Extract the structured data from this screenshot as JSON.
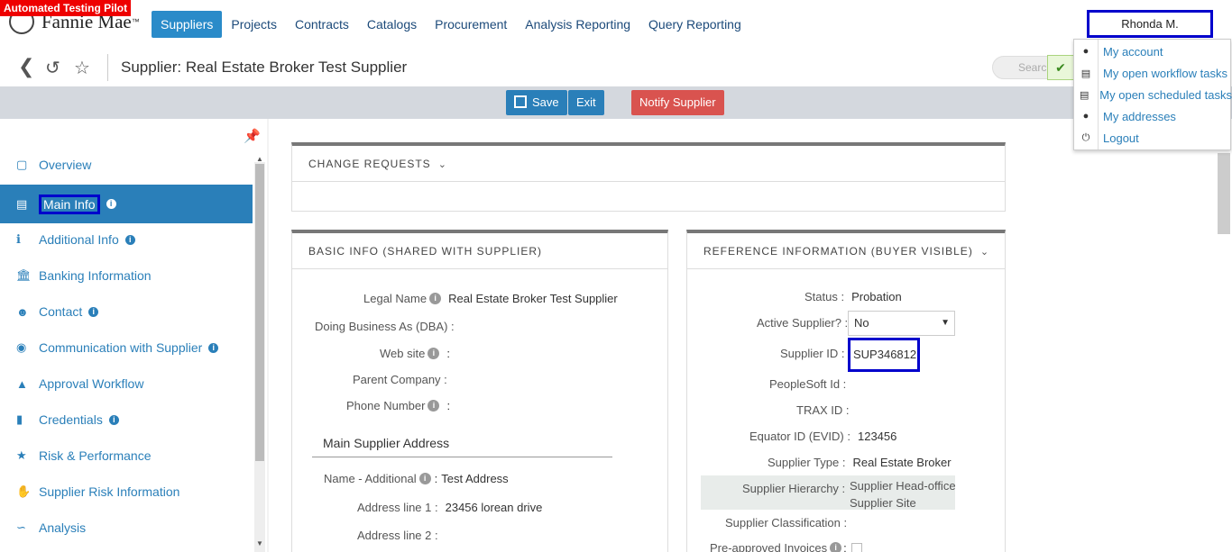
{
  "test_badge": "Automated Testing Pilot",
  "brand": {
    "name": "Fannie Mae",
    "tm": "™"
  },
  "nav": [
    {
      "label": "Suppliers",
      "active": true
    },
    {
      "label": "Projects"
    },
    {
      "label": "Contracts"
    },
    {
      "label": "Catalogs"
    },
    {
      "label": "Procurement"
    },
    {
      "label": "Analysis Reporting"
    },
    {
      "label": "Query Reporting"
    }
  ],
  "user": {
    "name": "Rhonda M."
  },
  "user_menu": [
    {
      "label": "My account",
      "icon": "user-icon"
    },
    {
      "label": "My open workflow tasks",
      "icon": "document-icon"
    },
    {
      "label": "My open scheduled tasks",
      "icon": "document-icon"
    },
    {
      "label": "My addresses",
      "icon": "user-icon"
    },
    {
      "label": "Logout",
      "icon": "power-icon"
    }
  ],
  "page_title": "Supplier: Real Estate Broker Test Supplier",
  "search": {
    "placeholder": "Search"
  },
  "actions": {
    "save": "Save",
    "exit": "Exit",
    "notify": "Notify Supplier"
  },
  "sidebar": [
    {
      "label": "Overview",
      "icon": "monitor-icon"
    },
    {
      "label": "Main Info",
      "icon": "id-card-icon",
      "active": true,
      "info": true
    },
    {
      "label": "Additional Info",
      "icon": "info-icon",
      "info": true
    },
    {
      "label": "Banking Information",
      "icon": "bank-icon"
    },
    {
      "label": "Contact",
      "icon": "users-icon",
      "info": true
    },
    {
      "label": "Communication with Supplier",
      "icon": "chat-icon",
      "info": true
    },
    {
      "label": "Approval Workflow",
      "icon": "workflow-icon"
    },
    {
      "label": "Credentials",
      "icon": "book-icon",
      "info": true
    },
    {
      "label": "Risk & Performance",
      "icon": "star-icon"
    },
    {
      "label": "Supplier Risk Information",
      "icon": "thumbs-up-icon"
    },
    {
      "label": "Analysis",
      "icon": "chart-icon"
    }
  ],
  "change_requests": {
    "title": "CHANGE REQUESTS"
  },
  "basic_info": {
    "title": "BASIC INFO (SHARED WITH SUPPLIER)",
    "legal_name_label": "Legal Name",
    "legal_name": "Real Estate Broker Test Supplier",
    "dba_label": "Doing Business As (DBA) :",
    "website_label": "Web site",
    "parent_label": "Parent Company :",
    "phone_label": "Phone Number",
    "address_heading": "Main Supplier Address",
    "addr_name_label": "Name - Additional",
    "addr_name": "Test Address",
    "line1_label": "Address line 1 :",
    "line1": "23456 lorean drive",
    "line2_label": "Address line 2 :"
  },
  "reference_info": {
    "title": "REFERENCE INFORMATION (BUYER VISIBLE)",
    "status_label": "Status :",
    "status": "Probation",
    "active_label": "Active Supplier? :",
    "active": "No",
    "supplier_id_label": "Supplier ID :",
    "supplier_id": "SUP346812",
    "peoplesoft_label": "PeopleSoft Id :",
    "trax_label": "TRAX ID :",
    "equator_label": "Equator ID (EVID) :",
    "equator": "123456",
    "type_label": "Supplier Type :",
    "type": "Real Estate Broker",
    "hierarchy_label": "Supplier Hierarchy :",
    "hierarchy_line1": "Supplier Head-office",
    "hierarchy_line2": "Supplier Site",
    "classification_label": "Supplier Classification :",
    "preapproved_label": "Pre-approved Invoices"
  }
}
